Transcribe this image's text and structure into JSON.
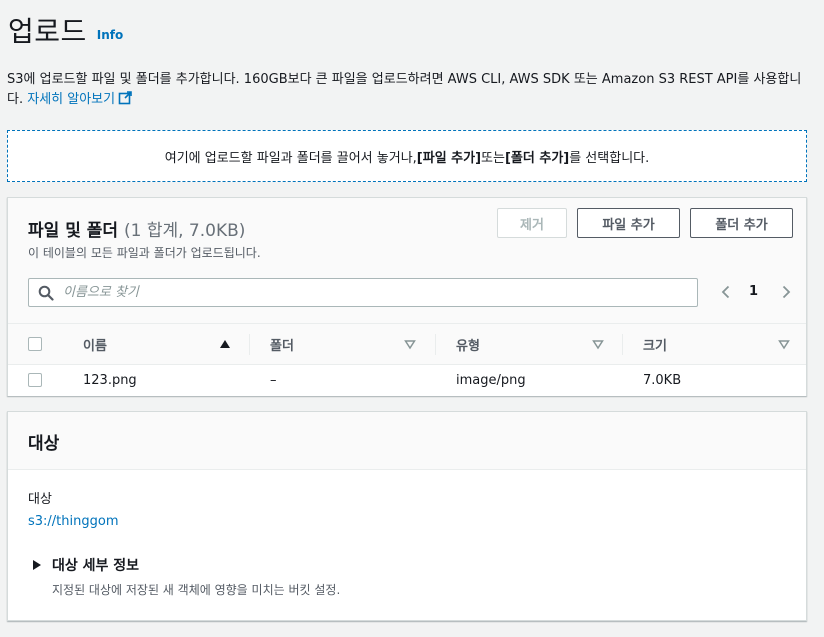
{
  "header": {
    "title": "업로드",
    "info_label": "Info"
  },
  "description": {
    "text": "S3에 업로드할 파일 및 폴더를 추가합니다. 160GB보다 큰 파일을 업로드하려면 AWS CLI, AWS SDK 또는 Amazon S3 REST API를 사용합니다.",
    "learn_more": "자세히 알아보기"
  },
  "dropzone": {
    "prefix": "여기에 업로드할 파일과 폴더를 끌어서 놓거나, ",
    "add_files": "[파일 추가]",
    "middle": " 또는 ",
    "add_folder": "[폴더 추가]",
    "suffix": "를 선택합니다."
  },
  "files": {
    "title": "파일 및 폴더",
    "count": "(1 합계, 7.0KB)",
    "subtitle": "이 테이블의 모든 파일과 폴더가 업로드됩니다.",
    "remove_label": "제거",
    "add_files_label": "파일 추가",
    "add_folder_label": "폴더 추가",
    "search_placeholder": "이름으로 찾기",
    "page": "1",
    "columns": [
      "이름",
      "폴더",
      "유형",
      "크기"
    ],
    "rows": [
      {
        "name": "123.png",
        "folder": "–",
        "type": "image/png",
        "size": "7.0KB"
      }
    ]
  },
  "destination": {
    "title": "대상",
    "label": "대상",
    "link": "s3://thinggom",
    "details_label": "대상 세부 정보",
    "details_desc": "지정된 대상에 저장된 새 객체에 영향을 미치는 버킷 설정."
  },
  "colors": {
    "link": "#0073bb",
    "background": "#f2f3f3"
  }
}
